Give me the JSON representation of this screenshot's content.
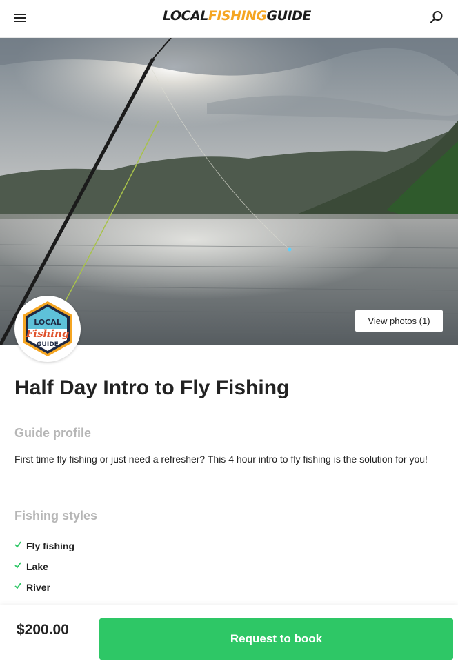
{
  "header": {
    "logo": {
      "part1": "LOCAL",
      "part2": "FISHING",
      "part3": "GUIDE"
    },
    "menu_icon": "hamburger-menu-icon",
    "search_icon": "search-icon"
  },
  "hero": {
    "view_photos_label": "View photos (1)",
    "avatar": {
      "line1": "LOCAL",
      "line2": "Fishing",
      "line3": "GUIDE"
    }
  },
  "listing": {
    "title": "Half Day Intro to Fly Fishing",
    "guide_profile_heading": "Guide profile",
    "description": "First time fly fishing or just need a refresher? This 4 hour intro to fly fishing is the solution for you!",
    "fishing_styles_heading": "Fishing styles",
    "fishing_styles": [
      "Fly fishing",
      "Lake",
      "River"
    ]
  },
  "booking": {
    "price": "$200.00",
    "button_label": "Request to book"
  },
  "colors": {
    "accent_green": "#2ec766",
    "logo_orange": "#f5a623",
    "heading_gray": "#b6b6b6"
  }
}
